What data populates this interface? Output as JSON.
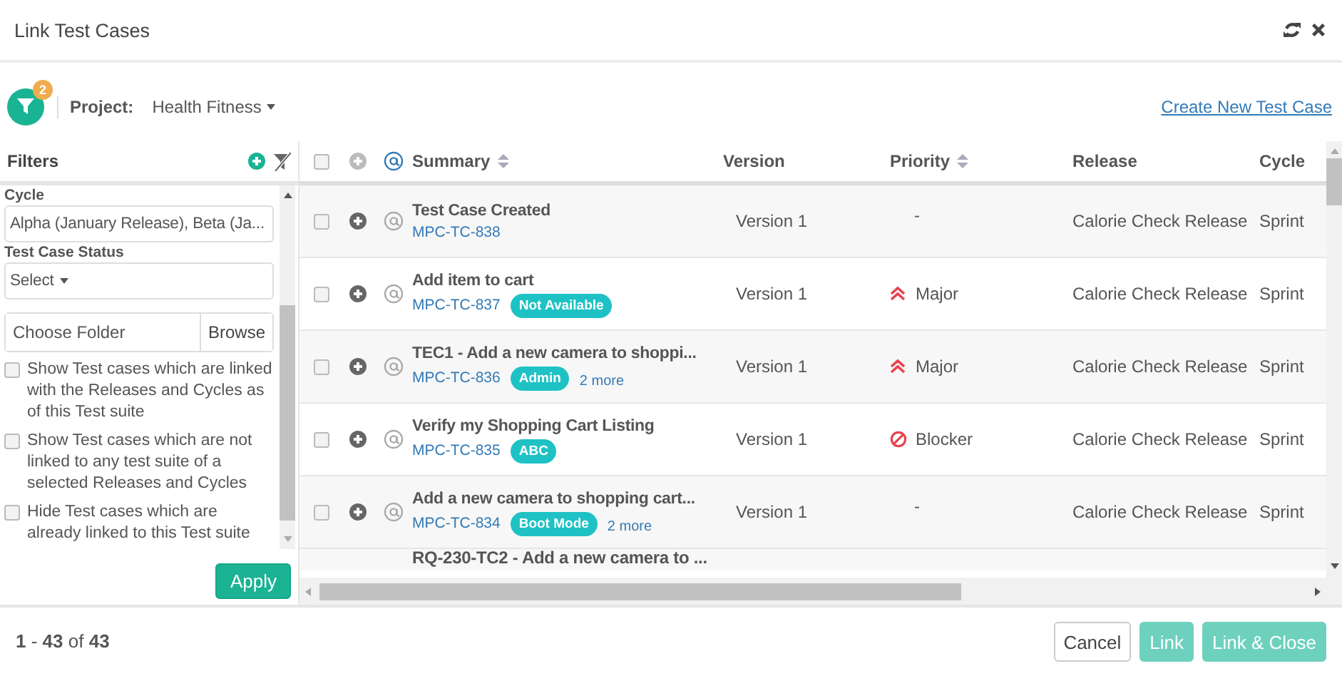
{
  "dialog": {
    "title": "Link Test Cases"
  },
  "toolbar": {
    "filter_count": "2",
    "project_label": "Project:",
    "project": "Health Fitness",
    "create_link": "Create New Test Case"
  },
  "filters": {
    "title": "Filters",
    "fields": [
      {
        "label": "Cycle",
        "value": "Alpha (January Release), Beta (Ja..."
      },
      {
        "label": "Test Case Status",
        "value": "Select"
      }
    ],
    "folder": {
      "placeholder": "Choose Folder",
      "button": "Browse"
    },
    "options": [
      {
        "label": "Show Test cases which are linked with the Releases and Cycles as of this Test suite",
        "checked": false
      },
      {
        "label": "Show Test cases which are not linked to any test suite of a selected Releases and Cycles",
        "checked": false
      },
      {
        "label": "Hide Test cases which are already linked to this Test suite",
        "checked": false
      }
    ],
    "apply": "Apply"
  },
  "table": {
    "select_all": {
      "checked": false
    },
    "columns": [
      {
        "label": "Summary",
        "sortable": true
      },
      {
        "label": "Version",
        "sortable": false
      },
      {
        "label": "Priority",
        "sortable": true
      },
      {
        "label": "Release",
        "sortable": false
      },
      {
        "label": "Cycle",
        "sortable": false
      }
    ],
    "rows": [
      {
        "summary": "Test Case Created",
        "id": "MPC-TC-838",
        "tags": [],
        "more": "",
        "version": "Version 1",
        "priority": {
          "kind": "none",
          "label": "-"
        },
        "release": "Calorie Check Release",
        "cycle": "Sprint",
        "checked": false
      },
      {
        "summary": "Add item to cart",
        "id": "MPC-TC-837",
        "tags": [
          "Not Available"
        ],
        "more": "",
        "version": "Version 1",
        "priority": {
          "kind": "major",
          "label": "Major"
        },
        "release": "Calorie Check Release",
        "cycle": "Sprint",
        "checked": false
      },
      {
        "summary": "TEC1 - Add a new camera to shoppi...",
        "id": "MPC-TC-836",
        "tags": [
          "Admin"
        ],
        "more": "2 more",
        "version": "Version 1",
        "priority": {
          "kind": "major",
          "label": "Major"
        },
        "release": "Calorie Check Release",
        "cycle": "Sprint",
        "checked": false
      },
      {
        "summary": "Verify my Shopping Cart Listing",
        "id": "MPC-TC-835",
        "tags": [
          "ABC"
        ],
        "more": "",
        "version": "Version 1",
        "priority": {
          "kind": "blocker",
          "label": "Blocker"
        },
        "release": "Calorie Check Release",
        "cycle": "Sprint",
        "checked": false
      },
      {
        "summary": "Add a new camera to shopping cart...",
        "id": "MPC-TC-834",
        "tags": [
          "Boot Mode"
        ],
        "more": "2 more",
        "version": "Version 1",
        "priority": {
          "kind": "none",
          "label": "-"
        },
        "release": "Calorie Check Release",
        "cycle": "Sprint",
        "checked": false
      }
    ],
    "partial_row": {
      "summary": "RQ-230-TC2 - Add a new camera to ..."
    }
  },
  "pagination": {
    "text": "**1** - **43** of **43**"
  },
  "buttons": [
    {
      "label": "Cancel",
      "kind": "secondary",
      "disabled": false
    },
    {
      "label": "Link",
      "kind": "primary",
      "disabled": true
    },
    {
      "label": "Link & Close",
      "kind": "primary",
      "disabled": true
    }
  ]
}
